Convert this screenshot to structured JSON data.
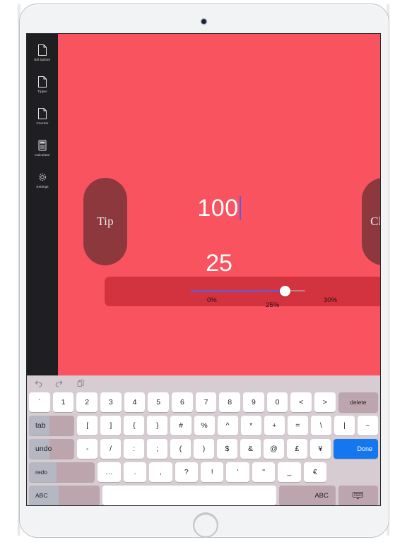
{
  "device": {
    "camera": "front-camera",
    "home_button": "home-button"
  },
  "sidebar": {
    "items": [
      {
        "label": "Bill Splitter",
        "icon": "page-icon"
      },
      {
        "label": "Tipper",
        "icon": "page-icon"
      },
      {
        "label": "Counter",
        "icon": "page-icon"
      },
      {
        "label": "Calculator",
        "icon": "calculator-icon"
      },
      {
        "label": "Settings",
        "icon": "gear-icon"
      }
    ]
  },
  "main": {
    "background_color": "#fa5360",
    "tip_button_label": "Tip",
    "clear_button_label": "Clear",
    "pill_color": "#8d383d",
    "amount_value": "100",
    "tip_result": "25",
    "caret_color": "#5b5ce0",
    "slider": {
      "card_color": "#d3333f",
      "min_label": "0%",
      "current_label": "25%",
      "max_label": "30%",
      "fill_color": "#5b5ce0",
      "percent": 25,
      "min": 0,
      "max": 30
    }
  },
  "keyboard": {
    "background_color": "#d6ccd2",
    "toolbar": [
      {
        "name": "undo-icon",
        "glyph": "↶"
      },
      {
        "name": "redo-icon",
        "glyph": "↷"
      },
      {
        "name": "paste-icon",
        "glyph": "❐"
      }
    ],
    "rows": [
      {
        "keys": [
          "`",
          "1",
          "2",
          "3",
          "4",
          "5",
          "6",
          "7",
          "8",
          "9",
          "0",
          "<",
          ">"
        ],
        "trailing": "delete"
      },
      {
        "leading": "tab",
        "keys": [
          "[",
          "]",
          "{",
          "}",
          "#",
          "%",
          "^",
          "*",
          "+",
          "=",
          "\\",
          "|",
          "~"
        ]
      },
      {
        "leading": "undo",
        "keys": [
          "-",
          "/",
          ":",
          ";",
          "(",
          ")",
          "$",
          "&",
          "@",
          "£",
          "¥"
        ],
        "trailing": "Done"
      },
      {
        "leading": "redo",
        "keys": [
          "…",
          ".",
          ",",
          "?",
          "!",
          "'",
          "\"",
          "_",
          "€"
        ]
      },
      {
        "leading": "ABC",
        "space": " ",
        "trailing": "ABC",
        "dismiss": "keyboard-dismiss-icon"
      }
    ]
  }
}
